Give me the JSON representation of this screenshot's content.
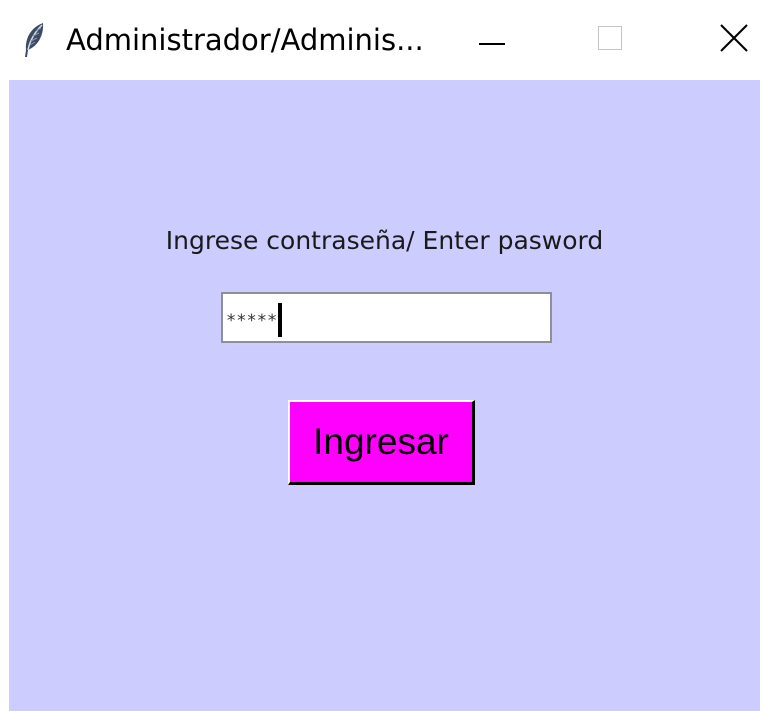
{
  "window": {
    "title": "Administrador/Adminis...",
    "icon": "feather-icon",
    "controls": {
      "minimize_icon": "minimize-icon",
      "maximize_icon": "maximize-icon",
      "close_icon": "close-icon"
    }
  },
  "login": {
    "prompt": "Ingrese contraseña/ Enter pasword",
    "password_value": "*****",
    "submit_label": "Ingresar"
  },
  "colors": {
    "background": "#ccccff",
    "button": "#ff00ff",
    "input": "#ffffff"
  }
}
